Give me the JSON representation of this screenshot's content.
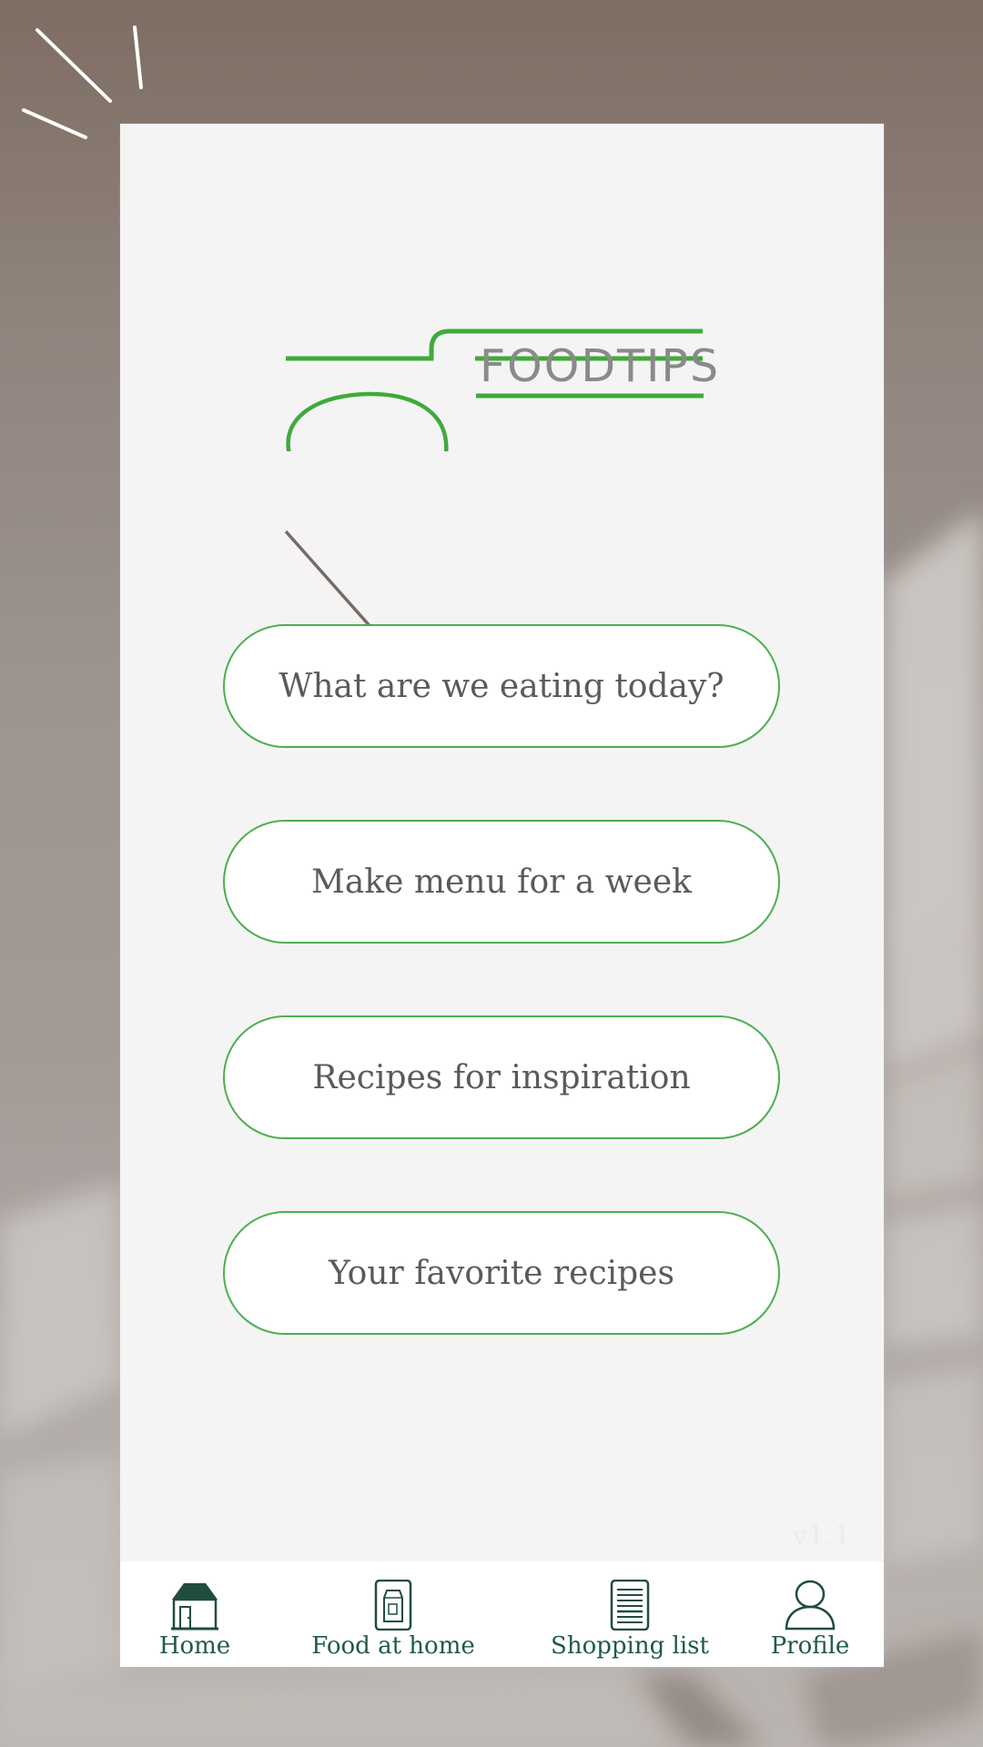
{
  "app": {
    "brand_name": "FOODTIPS",
    "version": "v1.1"
  },
  "colors": {
    "accent_green": "#4caf50",
    "nav_text": "#1f5a4a",
    "button_text": "#5a5a5e",
    "logo_text": "#8a8a8a",
    "panel_bg": "#f4f4f4"
  },
  "menu": {
    "buttons": [
      {
        "label": "What are we eating today?"
      },
      {
        "label": "Make menu for a week"
      },
      {
        "label": "Recipes for inspiration"
      },
      {
        "label": "Your favorite recipes"
      }
    ]
  },
  "navbar": {
    "items": [
      {
        "label": "Home",
        "icon": "home-icon",
        "active": true
      },
      {
        "label": "Food at home",
        "icon": "milk-carton-icon",
        "active": false
      },
      {
        "label": "Shopping list",
        "icon": "list-icon",
        "active": false
      },
      {
        "label": "Profile",
        "icon": "user-icon",
        "active": false
      }
    ]
  }
}
